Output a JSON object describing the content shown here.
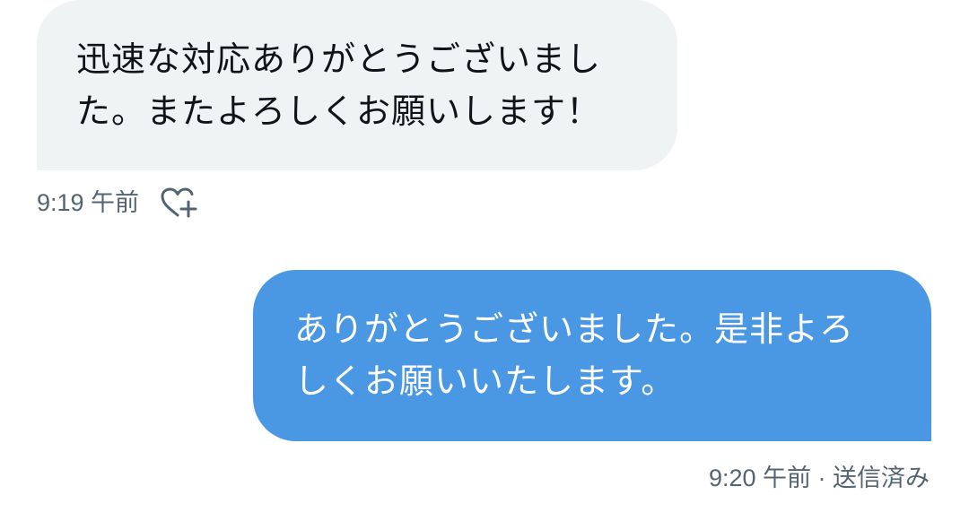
{
  "conversation": {
    "received": {
      "text": "迅速な対応ありがとうございまし\nた。またよろしくお願いします！",
      "time": "9:19 午前",
      "reaction_icon": "heart-plus-icon"
    },
    "sent": {
      "text": "ありがとうございました。是非よろ\nしくお願いいたします。",
      "meta": "9:20 午前 · 送信済み"
    }
  },
  "colors": {
    "received_bubble": "#eff3f4",
    "sent_bubble": "#4a98e4",
    "meta_text": "#536471"
  }
}
